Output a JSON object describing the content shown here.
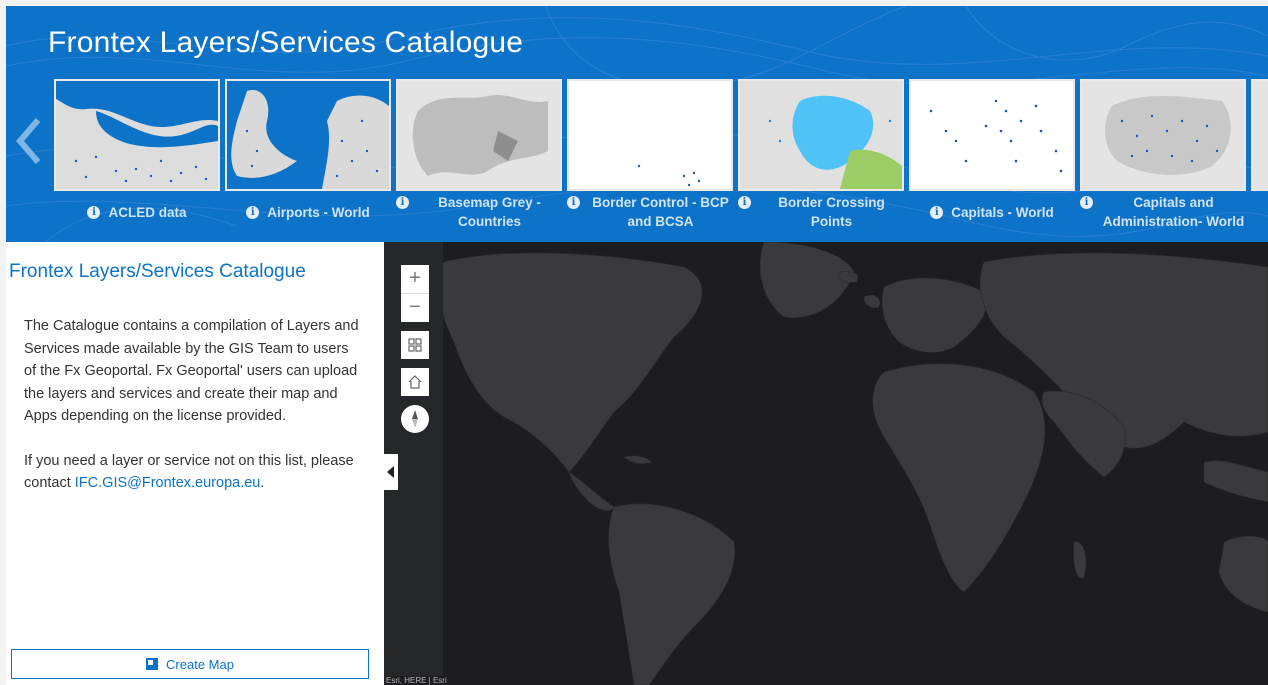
{
  "header": {
    "title": "Frontex Layers/Services Catalogue"
  },
  "carousel": {
    "items": [
      {
        "label": "ACLED data"
      },
      {
        "label": "Airports - World"
      },
      {
        "label": "Basemap Grey - Countries"
      },
      {
        "label": "Border Control - BCP and BCSA"
      },
      {
        "label": "Border Crossing Points"
      },
      {
        "label": "Capitals - World"
      },
      {
        "label": "Capitals and Administration- World"
      }
    ]
  },
  "panel": {
    "title": "Frontex Layers/Services Catalogue",
    "paragraph1": "The Catalogue contains a compilation of Layers and Services made available by the GIS Team to users of the Fx Geoportal. Fx Geoportal' users can upload the layers and services and create their map and Apps depending on the license provided.",
    "paragraph2_prefix": "If you need a layer or service not on this list, please contact ",
    "contact_email": "IFC.GIS@Frontex.europa.eu",
    "paragraph2_suffix": ".",
    "create_map_label": "Create Map"
  },
  "map": {
    "zoom_in": "+",
    "zoom_out": "−",
    "attribution": "Esri, HERE | Esri"
  },
  "colors": {
    "header_blue": "#0d73c9",
    "map_background": "#1d1d1f",
    "land_dark": "#3a3a3c"
  }
}
